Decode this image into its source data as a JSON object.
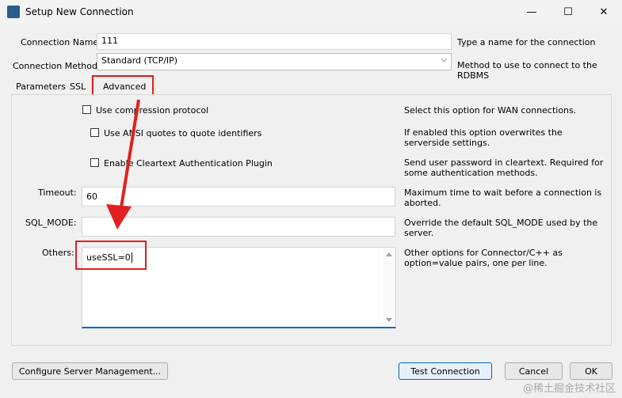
{
  "window": {
    "title": "Setup New Connection"
  },
  "controls": {
    "minimize": "—",
    "maximize": "☐",
    "close": "✕"
  },
  "connection_name": {
    "label": "Connection Name:",
    "value": "111",
    "help": "Type a name for the connection"
  },
  "connection_method": {
    "label": "Connection Method:",
    "value": "Standard (TCP/IP)",
    "help": "Method to use to connect to the RDBMS"
  },
  "tabs": [
    {
      "label": "Parameters"
    },
    {
      "label": "SSL"
    },
    {
      "label": "Advanced"
    }
  ],
  "advanced": {
    "compression": {
      "label": "Use compression protocol",
      "help": "Select this option for WAN connections."
    },
    "ansi": {
      "label": "Use ANSI quotes to quote identifiers",
      "help": "If enabled this option overwrites the serverside settings."
    },
    "cleartext": {
      "label": "Enable Cleartext Authentication Plugin",
      "help": "Send user password in cleartext. Required for some authentication methods."
    },
    "timeout": {
      "label": "Timeout:",
      "value": "60",
      "help": "Maximum time to wait before a connection is aborted."
    },
    "sql_mode": {
      "label": "SQL_MODE:",
      "value": "",
      "help": "Override the default SQL_MODE used by the server."
    },
    "others": {
      "label": "Others:",
      "value": "useSSL=0",
      "help": "Other options for Connector/C++ as option=value pairs, one per line."
    }
  },
  "buttons": {
    "configure": "Configure Server Management...",
    "test": "Test Connection",
    "cancel": "Cancel",
    "ok": "OK"
  },
  "watermark": "@稀土掘金技术社区",
  "colors": {
    "annotation_red": "#e02020",
    "focus_blue": "#0067c0"
  }
}
